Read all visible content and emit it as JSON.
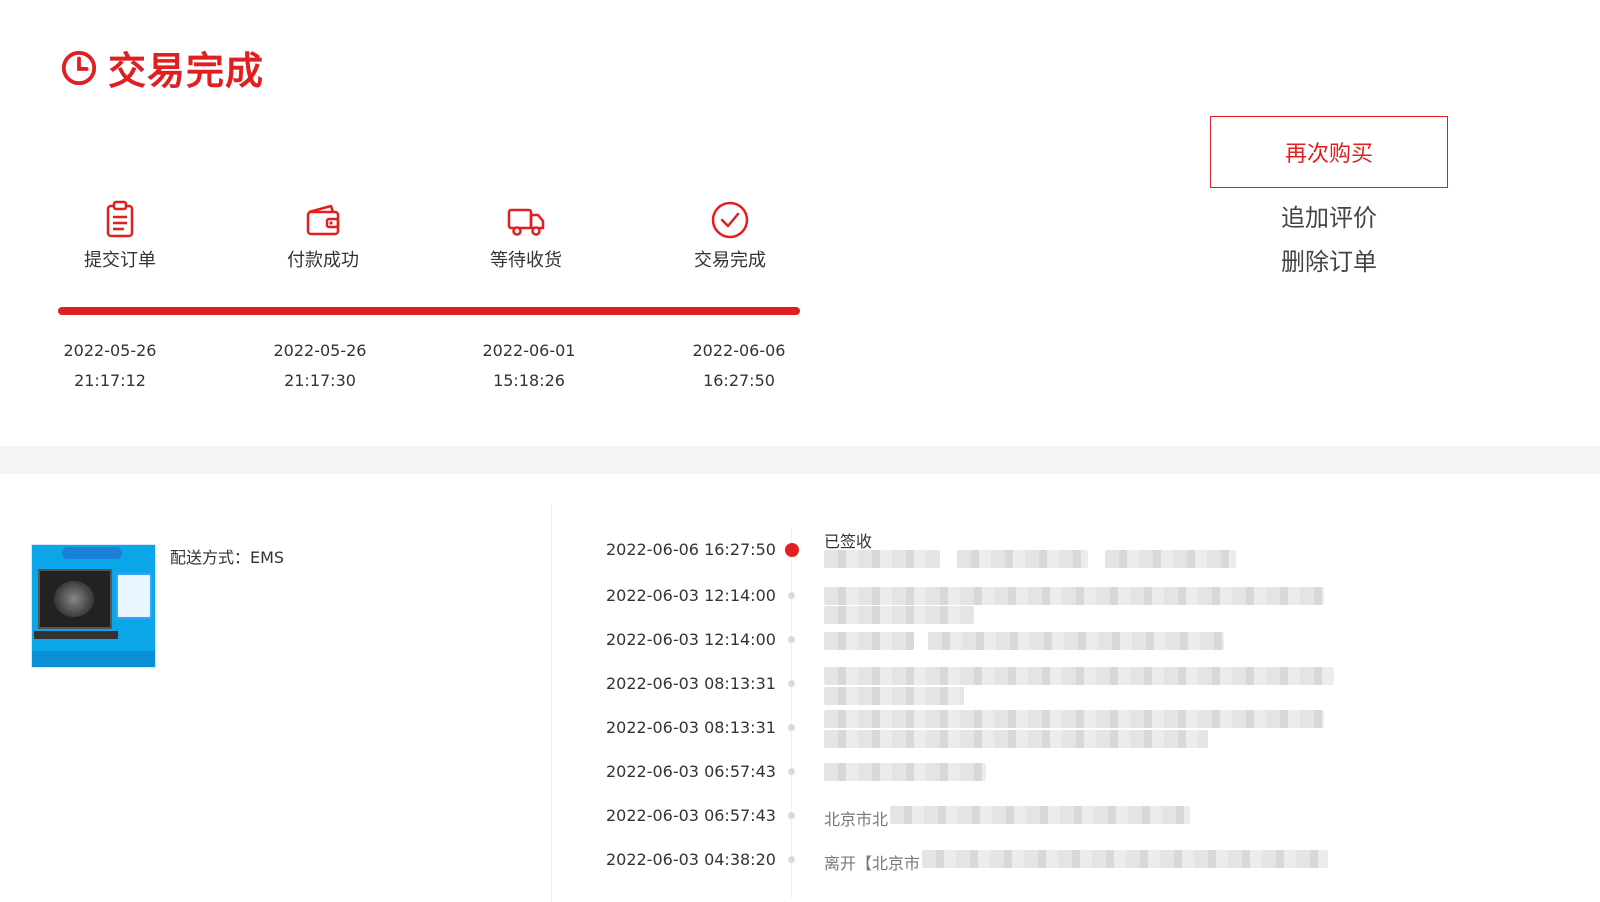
{
  "header": {
    "status": "交易完成",
    "accent_color": "#e02020",
    "status_icon": "clock-icon"
  },
  "steps": [
    {
      "label": "提交订单",
      "icon": "clipboard-icon",
      "date": "2022-05-26",
      "time": "21:17:12"
    },
    {
      "label": "付款成功",
      "icon": "wallet-icon",
      "date": "2022-05-26",
      "time": "21:17:30"
    },
    {
      "label": "等待收货",
      "icon": "truck-icon",
      "date": "2022-06-01",
      "time": "15:18:26"
    },
    {
      "label": "交易完成",
      "icon": "check-circle-icon",
      "date": "2022-06-06",
      "time": "16:27:50"
    }
  ],
  "actions": {
    "rebuy": "再次购买",
    "add_review": "追加评价",
    "delete_order": "删除订单"
  },
  "product": {
    "shipping": "配送方式：EMS"
  },
  "tracking": [
    {
      "time": "2022-06-06 16:27:50",
      "desc": "已签收",
      "active": true
    },
    {
      "time": "2022-06-03 12:14:00",
      "desc": ""
    },
    {
      "time": "2022-06-03 12:14:00",
      "desc": ""
    },
    {
      "time": "2022-06-03 08:13:31",
      "desc": ""
    },
    {
      "time": "2022-06-03 08:13:31",
      "desc": ""
    },
    {
      "time": "2022-06-03 06:57:43",
      "desc": ""
    },
    {
      "time": "2022-06-03 06:57:43",
      "desc": "北京市北"
    },
    {
      "time": "2022-06-03 04:38:20",
      "desc": "离开【北京市"
    }
  ]
}
